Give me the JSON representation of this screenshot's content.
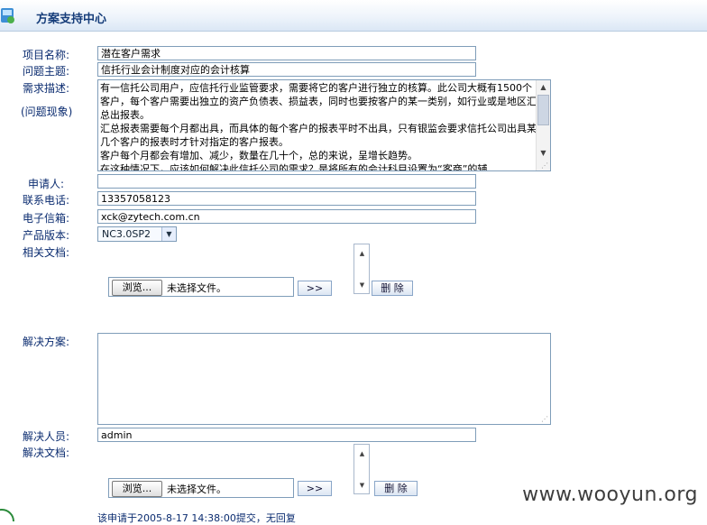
{
  "header": {
    "title": "方案支持中心"
  },
  "form": {
    "project_label": "项目名称:",
    "project_value": "潜在客户需求",
    "topic_label": "问题主题:",
    "topic_value": "信托行业会计制度对应的会计核算",
    "desc_label": "需求描述:",
    "desc_sublabel": "(问题现象)",
    "desc_value": "有一信托公司用户，应信托行业监管要求，需要将它的客户进行独立的核算。此公司大概有1500个客户，每个客户需要出独立的资产负债表、损益表，同时也要按客户的某一类别，如行业或是地区汇总出报表。\n汇总报表需要每个月都出具，而具体的每个客户的报表平时不出具，只有银监会要求信托公司出具某几个客户的报表时才针对指定的客户报表。\n客户每个月都会有增加、减少，数量在几十个，总的来说，呈增长趋势。\n在这种情况下，应该如何解决此信托公司的需求？是将所有的会计科目设置为“客商”的辅",
    "applicant_label": "申请人:",
    "applicant_value": "",
    "phone_label": "联系电话:",
    "phone_value": "13357058123",
    "email_label": "电子信箱:",
    "email_value": "xck@zytech.com.cn",
    "version_label": "产品版本:",
    "version_value": "NC3.0SP2",
    "docs_label": "相关文档:",
    "browse_label": "浏览...",
    "no_file_label": "未选择文件。",
    "add_label": ">>",
    "delete_label": "删 除",
    "solution_label": "解决方案:",
    "solution_value": "",
    "solver_label": "解决人员:",
    "solver_value": "admin",
    "solution_docs_label": "解决文档:",
    "browse_label_2": "浏览...",
    "no_file_label_2": "未选择文件。",
    "add_label_2": ">>",
    "delete_label_2": "删 除"
  },
  "footer": {
    "note": "该申请于2005-8-17 14:38:00提交，无回复"
  },
  "watermark": "www.wooyun.org"
}
